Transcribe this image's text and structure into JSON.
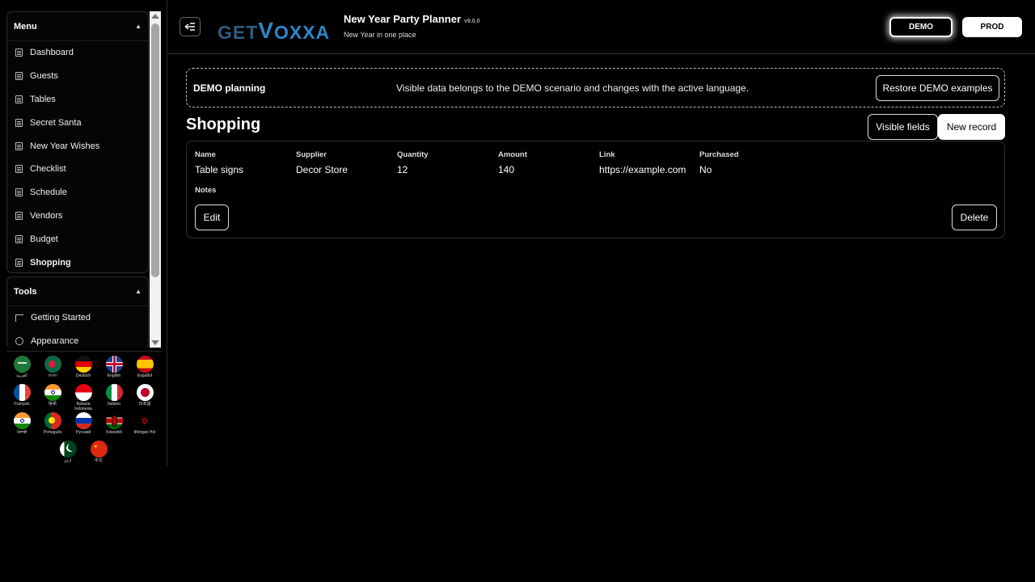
{
  "sidebar": {
    "menu_title": "Menu",
    "menu_items": [
      {
        "label": "Dashboard"
      },
      {
        "label": "Guests"
      },
      {
        "label": "Tables"
      },
      {
        "label": "Secret Santa"
      },
      {
        "label": "New Year Wishes"
      },
      {
        "label": "Checklist"
      },
      {
        "label": "Schedule"
      },
      {
        "label": "Vendors"
      },
      {
        "label": "Budget"
      },
      {
        "label": "Shopping",
        "active": true
      }
    ],
    "tools_title": "Tools",
    "tools_items": [
      {
        "label": "Getting Started"
      },
      {
        "label": "Appearance"
      }
    ],
    "languages": [
      {
        "label": "العربية",
        "icon": "flag-saudi-arabia"
      },
      {
        "label": "বাংলা",
        "icon": "flag-bangladesh"
      },
      {
        "label": "Deutsch",
        "icon": "flag-germany"
      },
      {
        "label": "English",
        "icon": "flag-uk"
      },
      {
        "label": "Español",
        "icon": "flag-spain"
      },
      {
        "label": "Français",
        "icon": "flag-france"
      },
      {
        "label": "हिन्दी",
        "icon": "flag-india"
      },
      {
        "label": "Bahasa Indonesia",
        "icon": "flag-indonesia"
      },
      {
        "label": "Italiano",
        "icon": "flag-italy"
      },
      {
        "label": "日本語",
        "icon": "flag-japan"
      },
      {
        "label": "ਪੰਜਾਬੀ",
        "icon": "flag-india"
      },
      {
        "label": "Português",
        "icon": "flag-portugal"
      },
      {
        "label": "Русский",
        "icon": "flag-russia"
      },
      {
        "label": "Kiswahili",
        "icon": "flag-kenya"
      },
      {
        "label": "tlhIngan Hol",
        "icon": "klingon-emblem"
      },
      {
        "label": "اردو",
        "icon": "flag-pakistan"
      },
      {
        "label": "中文",
        "icon": "flag-china"
      }
    ]
  },
  "header": {
    "logo_get": "GET",
    "logo_v": "V",
    "logo_oxxa": "OXXA",
    "title": "New Year Party Planner",
    "version": "v9.0.0",
    "subtitle": "New Year in one place",
    "demo_label": "DEMO",
    "prod_label": "PROD"
  },
  "banner": {
    "title": "DEMO planning",
    "text": "Visible data belongs to the DEMO scenario and changes with the active language.",
    "restore_label": "Restore DEMO examples"
  },
  "main": {
    "page_title": "Shopping",
    "visible_fields_label": "Visible fields",
    "new_record_label": "New record",
    "record": {
      "fields": [
        {
          "key": "Name",
          "value": "Table signs"
        },
        {
          "key": "Supplier",
          "value": "Decor Store"
        },
        {
          "key": "Quantity",
          "value": "12"
        },
        {
          "key": "Amount",
          "value": "140"
        },
        {
          "key": "Link",
          "value": "https://example.com"
        },
        {
          "key": "Purchased",
          "value": "No"
        }
      ],
      "notes_label": "Notes",
      "edit_label": "Edit",
      "delete_label": "Delete"
    }
  }
}
